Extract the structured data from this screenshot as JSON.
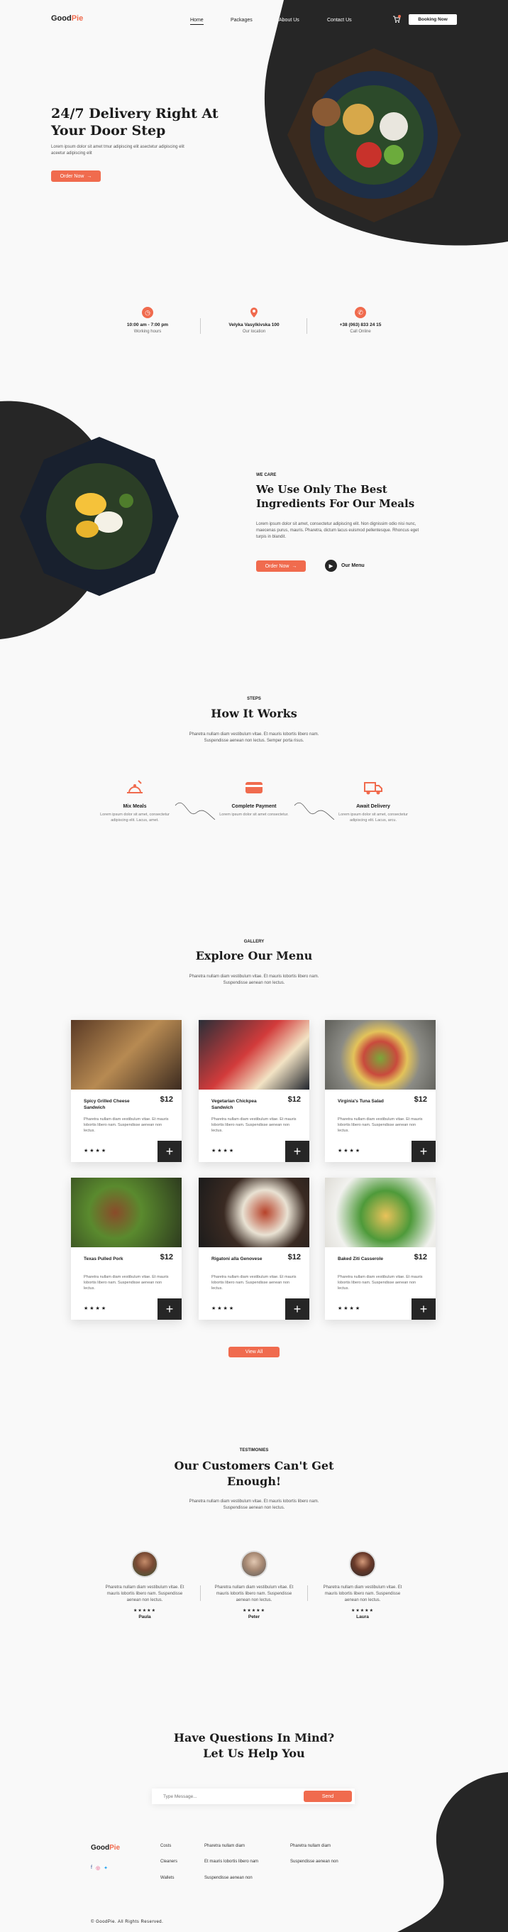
{
  "colors": {
    "accent": "#f06b4e",
    "dark": "#262626",
    "background": "#f9f9f9"
  },
  "brand": {
    "name_part1": "Good",
    "name_part2": "Pie"
  },
  "nav": {
    "home": "Home",
    "packages": "Packages",
    "about": "About Us",
    "contact": "Contact Us",
    "booking": "Booking Now",
    "cart_icon": "cart-icon"
  },
  "hero": {
    "title_line1": "24/7 Delivery Right At",
    "title_line2": "Your Door Step",
    "text": "Lorem ipsum dolor sit amet tmur adipiscing elit asectetur adipiscing elit aceetur adipiscing elit",
    "button": "Order Now"
  },
  "info": [
    {
      "icon": "clock-icon",
      "title": "10:00 am - 7:00 pm",
      "sub": "Working hours"
    },
    {
      "icon": "location-pin-icon",
      "title": "Velyka Vasylkivska 100",
      "sub": "Our location"
    },
    {
      "icon": "phone-icon",
      "title": "+38 (063) 833 24 15",
      "sub": "Call Online"
    }
  ],
  "care": {
    "eyebrow": "WE CARE",
    "title_line1": "We Use Only The Best",
    "title_line2": "Ingredients For Our Meals",
    "text": "Lorem ipsum dolor sit amet, consectetur adipiscing elit. Non dignissim odio nisi nunc, maecenas purus, mauris. Pharetra, dictum lacus euismod pellentesque. Rhoncus eget turpis in blandit.",
    "button": "Order Now",
    "menu_link": "Our Menu"
  },
  "steps": {
    "eyebrow": "STEPS",
    "title": "How It Works",
    "text_line1": "Pharetra nullam diam vestibulum vitae. Et mauris lobortis libero nam.",
    "text_line2": "Suspendisse aenean non lectus. Semper porta risus.",
    "items": [
      {
        "icon": "meal-icon",
        "title": "Mix Meals",
        "text": "Lorem ipsum dolor sit amet, consectetur adipiscing elit. Lacus, amet."
      },
      {
        "icon": "credit-card-icon",
        "title": "Complete Payment",
        "text": "Lorem ipsum dolor sit amet consectetur."
      },
      {
        "icon": "delivery-truck-icon",
        "title": "Await Delivery",
        "text": "Lorem ipsum dolor sit amet, consectetur adipiscing elit. Lacus, arcu."
      }
    ]
  },
  "gallery": {
    "eyebrow": "GALLERY",
    "title": "Explore Our Menu",
    "text_line1": "Pharetra nullam diam vestibulum vitae. Et mauris lobortis libero nam.",
    "text_line2": "Suspendisse aenean non lectus.",
    "view_all": "View All",
    "cards": [
      {
        "name": "Spicy Grilled Cheese Sandwich",
        "price": "$12",
        "desc": "Pharetra nullam diam vestibulum vitae. Et mauris lobortis libero nam. Suspendisse aenean non lectus.",
        "stars": "★★★★"
      },
      {
        "name": "Vegetarian Chickpea Sandwich",
        "price": "$12",
        "desc": "Pharetra nullam diam vestibulum vitae. Et mauris lobortis libero nam. Suspendisse aenean non lectus.",
        "stars": "★★★★"
      },
      {
        "name": "Virginia's Tuna Salad",
        "price": "$12",
        "desc": "Pharetra nullam diam vestibulum vitae. Et mauris lobortis libero nam. Suspendisse aenean non lectus.",
        "stars": "★★★★"
      },
      {
        "name": "Texas Pulled Pork",
        "price": "$12",
        "desc": "Pharetra nullam diam vestibulum vitae. Et mauris lobortis libero nam. Suspendisse aenean non lectus.",
        "stars": "★★★★"
      },
      {
        "name": "Rigatoni alla Genovese",
        "price": "$12",
        "desc": "Pharetra nullam diam vestibulum vitae. Et mauris lobortis libero nam. Suspendisse aenean non lectus.",
        "stars": "★★★★"
      },
      {
        "name": "Baked Ziti Casserole",
        "price": "$12",
        "desc": "Pharetra nullam diam vestibulum vitae. Et mauris lobortis libero nam. Suspendisse aenean non lectus.",
        "stars": "★★★★"
      }
    ]
  },
  "testimonials": {
    "eyebrow": "TESTIMONIES",
    "title_line1": "Our Customers Can't Get",
    "title_line2": "Enough!",
    "text_line1": "Pharetra nullam diam vestibulum vitae. Et mauris lobortis libero nam.",
    "text_line2": "Suspendisse aenean non lectus.",
    "items": [
      {
        "quote": "Pharetra nullam diam vestibulum vitae. Et mauris lobortis libero nam. Suspendisse aenean non lectus.",
        "stars": "★★★★★",
        "name": "Paula"
      },
      {
        "quote": "Pharetra nullam diam vestibulum vitae. Et mauris lobortis libero nam. Suspendisse aenean non lectus.",
        "stars": "★★★★★",
        "name": "Peter"
      },
      {
        "quote": "Pharetra nullam diam vestibulum vitae. Et mauris lobortis libero nam. Suspendisse aenean non lectus.",
        "stars": "★★★★★",
        "name": "Laura"
      }
    ]
  },
  "contact": {
    "title_line1": "Have Questions In Mind?",
    "title_line2": "Let Us Help You",
    "placeholder": "Type Message...",
    "send": "Send"
  },
  "footer": {
    "col1": [
      "Costs",
      "Cleaners",
      "Wallets"
    ],
    "col2": [
      "Pharetra nullam diam",
      "Et mauris lobortis libero nam",
      "Suspendisse aenean non"
    ],
    "col3": [
      "Pharetra nullam diam",
      "Suspendisse aenean non"
    ],
    "copyright": "© GoodPie. All Rights Reserved."
  }
}
